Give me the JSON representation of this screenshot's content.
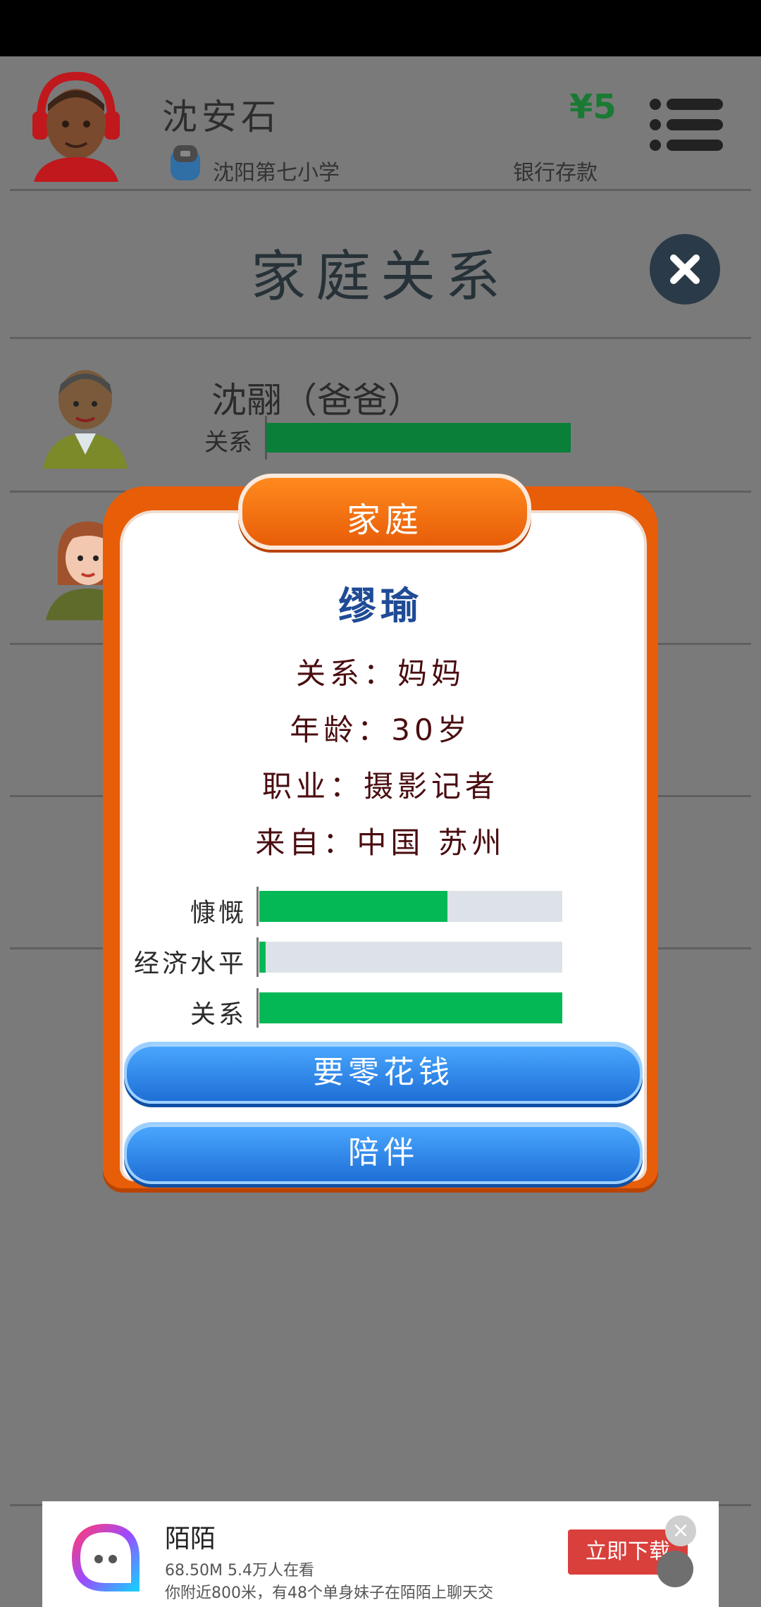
{
  "header": {
    "player_name": "沈安石",
    "school": "沈阳第七小学",
    "money": "¥5",
    "bank_label": "银行存款"
  },
  "section": {
    "title": "家庭关系"
  },
  "family_list": [
    {
      "name": "沈翮（爸爸）",
      "relation_label": "关系",
      "relation_level": 0.72
    }
  ],
  "dialog": {
    "tab_label": "家庭",
    "name": "缪瑜",
    "info": {
      "relation": "关系：妈妈",
      "age": "年龄：30岁",
      "job": "职业：摄影记者",
      "origin": "来自：中国 苏州"
    },
    "stats": [
      {
        "label": "慷慨",
        "value": 0.62
      },
      {
        "label": "经济水平",
        "value": 0.02
      },
      {
        "label": "关系",
        "value": 1.0
      }
    ],
    "buttons": {
      "ask_money": "要零花钱",
      "accompany": "陪伴"
    }
  },
  "ad": {
    "title": "陌陌",
    "subtitle1": "68.50M 5.4万人在看",
    "subtitle2": "你附近800米，有48个单身妹子在陌陌上聊天交",
    "cta": "立即下载"
  },
  "colors": {
    "accent_orange": "#e85d08",
    "bar_green": "#05b856",
    "button_blue": "#1f6fd6",
    "money_green": "#1a7a34"
  }
}
